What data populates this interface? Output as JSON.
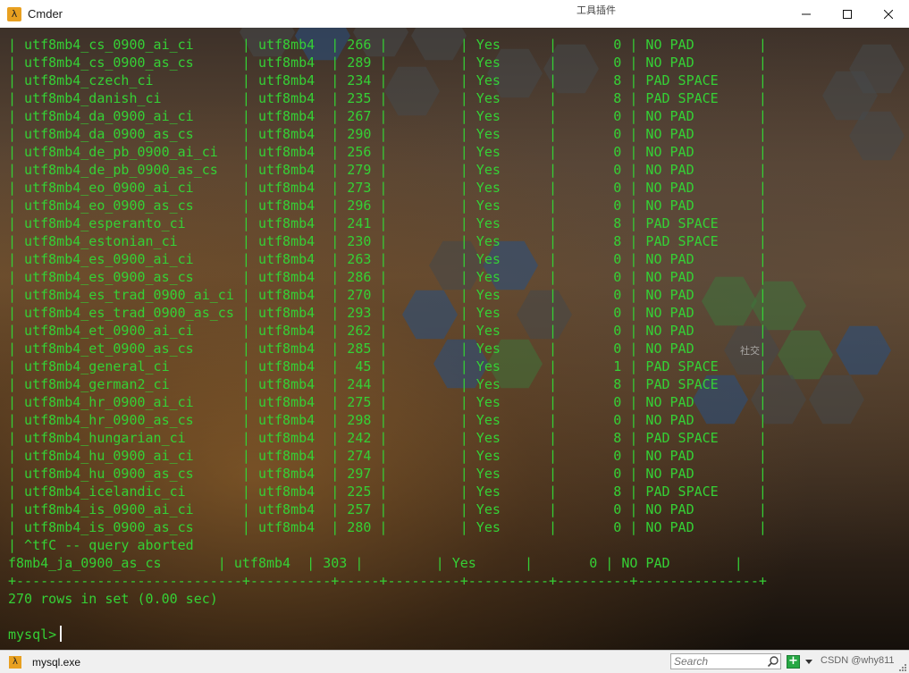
{
  "window": {
    "title": "Cmder",
    "app_icon": "λ",
    "controls": [
      "minimize-icon",
      "maximize-icon",
      "close-icon"
    ]
  },
  "desktop_overlay": {
    "top_label": "工具插件",
    "side_label": "社交",
    "colors": {
      "terminal_green": "#35d035"
    }
  },
  "terminal": {
    "lines": [
      "| utf8mb4_cs_0900_ai_ci      | utf8mb4  | 266 |         | Yes      |       0 | NO PAD        |",
      "| utf8mb4_cs_0900_as_cs      | utf8mb4  | 289 |         | Yes      |       0 | NO PAD        |",
      "| utf8mb4_czech_ci           | utf8mb4  | 234 |         | Yes      |       8 | PAD SPACE     |",
      "| utf8mb4_danish_ci          | utf8mb4  | 235 |         | Yes      |       8 | PAD SPACE     |",
      "| utf8mb4_da_0900_ai_ci      | utf8mb4  | 267 |         | Yes      |       0 | NO PAD        |",
      "| utf8mb4_da_0900_as_cs      | utf8mb4  | 290 |         | Yes      |       0 | NO PAD        |",
      "| utf8mb4_de_pb_0900_ai_ci   | utf8mb4  | 256 |         | Yes      |       0 | NO PAD        |",
      "| utf8mb4_de_pb_0900_as_cs   | utf8mb4  | 279 |         | Yes      |       0 | NO PAD        |",
      "| utf8mb4_eo_0900_ai_ci      | utf8mb4  | 273 |         | Yes      |       0 | NO PAD        |",
      "| utf8mb4_eo_0900_as_cs      | utf8mb4  | 296 |         | Yes      |       0 | NO PAD        |",
      "| utf8mb4_esperanto_ci       | utf8mb4  | 241 |         | Yes      |       8 | PAD SPACE     |",
      "| utf8mb4_estonian_ci        | utf8mb4  | 230 |         | Yes      |       8 | PAD SPACE     |",
      "| utf8mb4_es_0900_ai_ci      | utf8mb4  | 263 |         | Yes      |       0 | NO PAD        |",
      "| utf8mb4_es_0900_as_cs      | utf8mb4  | 286 |         | Yes      |       0 | NO PAD        |",
      "| utf8mb4_es_trad_0900_ai_ci | utf8mb4  | 270 |         | Yes      |       0 | NO PAD        |",
      "| utf8mb4_es_trad_0900_as_cs | utf8mb4  | 293 |         | Yes      |       0 | NO PAD        |",
      "| utf8mb4_et_0900_ai_ci      | utf8mb4  | 262 |         | Yes      |       0 | NO PAD        |",
      "| utf8mb4_et_0900_as_cs      | utf8mb4  | 285 |         | Yes      |       0 | NO PAD        |",
      "| utf8mb4_general_ci         | utf8mb4  |  45 |         | Yes      |       1 | PAD SPACE     |",
      "| utf8mb4_german2_ci         | utf8mb4  | 244 |         | Yes      |       8 | PAD SPACE     |",
      "| utf8mb4_hr_0900_ai_ci      | utf8mb4  | 275 |         | Yes      |       0 | NO PAD        |",
      "| utf8mb4_hr_0900_as_cs      | utf8mb4  | 298 |         | Yes      |       0 | NO PAD        |",
      "| utf8mb4_hungarian_ci       | utf8mb4  | 242 |         | Yes      |       8 | PAD SPACE     |",
      "| utf8mb4_hu_0900_ai_ci      | utf8mb4  | 274 |         | Yes      |       0 | NO PAD        |",
      "| utf8mb4_hu_0900_as_cs      | utf8mb4  | 297 |         | Yes      |       0 | NO PAD        |",
      "| utf8mb4_icelandic_ci       | utf8mb4  | 225 |         | Yes      |       8 | PAD SPACE     |",
      "| utf8mb4_is_0900_ai_ci      | utf8mb4  | 257 |         | Yes      |       0 | NO PAD        |",
      "| utf8mb4_is_0900_as_cs      | utf8mb4  | 280 |         | Yes      |       0 | NO PAD        |",
      "| ^tfC -- query aborted",
      "f8mb4_ja_0900_as_cs       | utf8mb4  | 303 |         | Yes      |       0 | NO PAD        |",
      "+----------------------------+----------+-----+---------+----------+---------+---------------+",
      "270 rows in set (0.00 sec)",
      ""
    ],
    "prompt": "mysql>"
  },
  "statusbar": {
    "tab_label": "mysql.exe",
    "search_placeholder": "Search",
    "add_label": "+",
    "watermark": "CSDN @why811"
  }
}
